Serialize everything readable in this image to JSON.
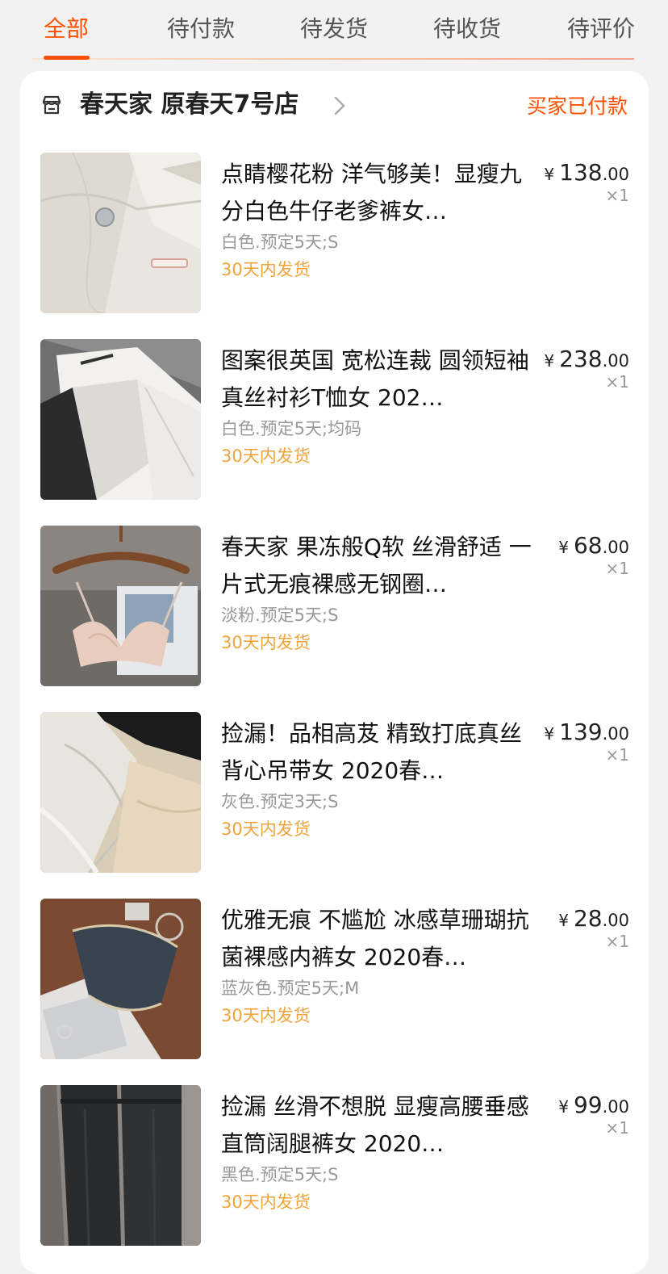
{
  "tabs": [
    {
      "label": "全部",
      "active": true
    },
    {
      "label": "待付款",
      "active": false
    },
    {
      "label": "待发货",
      "active": false
    },
    {
      "label": "待收货",
      "active": false
    },
    {
      "label": "待评价",
      "active": false
    }
  ],
  "shop": {
    "icon": "store-icon",
    "name": "春天家 原春天7号店",
    "status": "买家已付款"
  },
  "items": [
    {
      "title": "点睛樱花粉 洋气够美！显瘦九分白色牛仔老爹裤女…",
      "spec": "白色.预定5天;S",
      "shipping": "30天内发货",
      "currency": "¥",
      "price_int": "138",
      "price_dec": ".00",
      "qty": "×1"
    },
    {
      "title": "图案很英国 宽松连裁 圆领短袖真丝衬衫T恤女 202…",
      "spec": "白色.预定5天;均码",
      "shipping": "30天内发货",
      "currency": "¥",
      "price_int": "238",
      "price_dec": ".00",
      "qty": "×1"
    },
    {
      "title": "春天家 果冻般Q软 丝滑舒适 一片式无痕裸感无钢圈…",
      "spec": "淡粉.预定5天;S",
      "shipping": "30天内发货",
      "currency": "¥",
      "price_int": "68",
      "price_dec": ".00",
      "qty": "×1"
    },
    {
      "title": "捡漏！品相高芨 精致打底真丝背心吊带女 2020春…",
      "spec": "灰色.预定3天;S",
      "shipping": "30天内发货",
      "currency": "¥",
      "price_int": "139",
      "price_dec": ".00",
      "qty": "×1"
    },
    {
      "title": "优雅无痕 不尴尬 冰感草珊瑚抗菌裸感内裤女 2020春…",
      "spec": "蓝灰色.预定5天;M",
      "shipping": "30天内发货",
      "currency": "¥",
      "price_int": "28",
      "price_dec": ".00",
      "qty": "×1"
    },
    {
      "title": "捡漏 丝滑不想脱 显瘦高腰垂感直筒阔腿裤女 2020…",
      "spec": "黑色.预定5天;S",
      "shipping": "30天内发货",
      "currency": "¥",
      "price_int": "99",
      "price_dec": ".00",
      "qty": "×1"
    }
  ],
  "colors": {
    "accent": "#ff5000",
    "shipping": "#f0a43a",
    "muted": "#999999"
  }
}
